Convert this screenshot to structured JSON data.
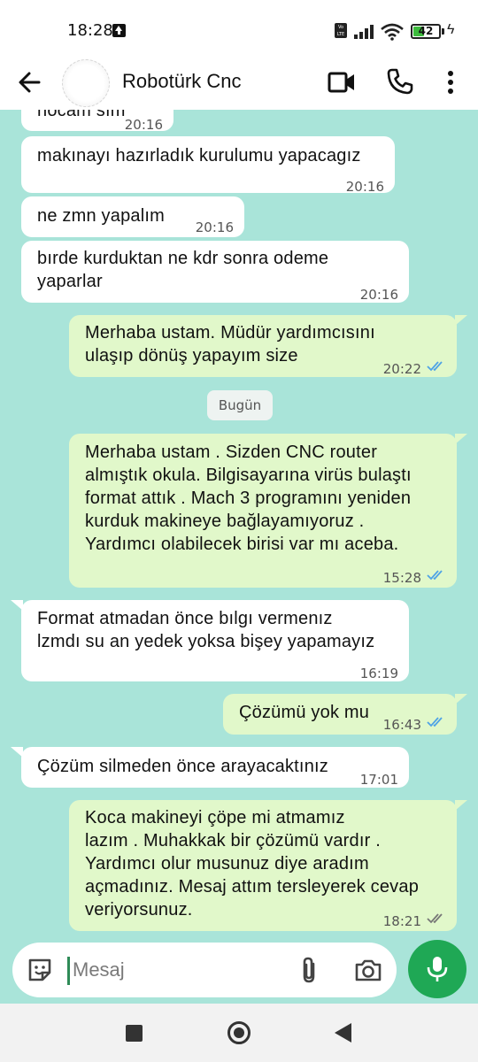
{
  "status_bar": {
    "time": "18:28",
    "network_label": "Vo LTE",
    "battery_level": "42",
    "battery_fraction": 0.42
  },
  "header": {
    "contact_name": "Robotürk Cnc",
    "icons": [
      "back-arrow-icon",
      "video-call-icon",
      "phone-call-icon",
      "more-vert-icon"
    ]
  },
  "chat": {
    "messages": [
      {
        "direction": "in",
        "text": "hocam  sım",
        "time": "20:16"
      },
      {
        "direction": "in",
        "text": "makınayı  hazırladık kurulumu yapacagız",
        "time": "20:16"
      },
      {
        "direction": "in",
        "text": "ne  zmn  yapalım",
        "time": "20:16"
      },
      {
        "direction": "in",
        "lines": [
          "bırde  kurduktan  ne  kdr  sonra  odeme",
          "yaparlar"
        ],
        "time": "20:16"
      },
      {
        "direction": "out",
        "lines": [
          "Merhaba ustam. Müdür yardımcısını",
          "ulaşıp dönüş yapayım size"
        ],
        "time": "20:22",
        "status": "read"
      },
      {
        "direction": "out",
        "lines": [
          "Merhaba ustam . Sizden CNC router",
          "almıştık okula. Bilgisayarına virüs bulaştı",
          "format attık . Mach 3 programını yeniden",
          "kurduk makineye bağlayamıyoruz .",
          "Yardımcı olabilecek birisi var mı aceba."
        ],
        "time": "15:28",
        "status": "read"
      },
      {
        "direction": "in",
        "lines": [
          "Format atmadan önce bılgı vermenız",
          "lzmdı su an yedek yoksa bişey yapamayız"
        ],
        "time": "16:19"
      },
      {
        "direction": "out",
        "text": "Çözümü yok mu",
        "time": "16:43",
        "status": "read"
      },
      {
        "direction": "in",
        "text": "Çözüm silmeden önce arayacaktınız",
        "time": "17:01"
      },
      {
        "direction": "out",
        "lines": [
          "Koca makineyi çöpe mi atmamız",
          "lazım . Muhakkak bir çözümü vardır .",
          "Yardımcı olur musunuz diye aradım",
          "açmadınız. Mesaj attım tersleyerek cevap",
          "veriyorsunuz."
        ],
        "time": "18:21",
        "status": "delivered"
      }
    ],
    "date_divider": "Bugün"
  },
  "composer": {
    "placeholder": "Mesaj",
    "icons": [
      "emoji-icon",
      "attach-icon",
      "camera-icon",
      "mic-icon"
    ]
  },
  "colors": {
    "chat_background": "#a9e4d9",
    "incoming_bubble": "#ffffff",
    "outgoing_bubble": "#e1f8ca",
    "read_ticks": "#4fa3e6",
    "mic_button": "#1fa855"
  }
}
